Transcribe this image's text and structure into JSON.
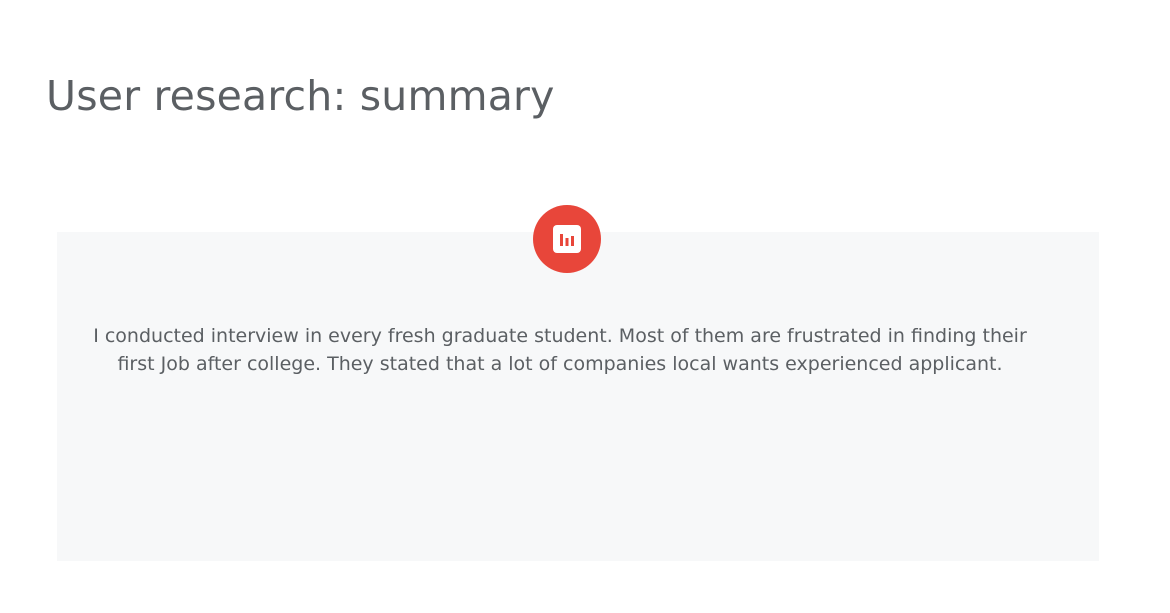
{
  "header": {
    "title": "User research: summary"
  },
  "card": {
    "icon": "bar-chart-icon",
    "accent_color": "#e8463a",
    "background_color": "#f7f8f9",
    "text": "I conducted interview in every fresh graduate student. Most of them are frustrated in finding their first Job after college. They stated that a lot of companies local wants experienced applicant."
  }
}
